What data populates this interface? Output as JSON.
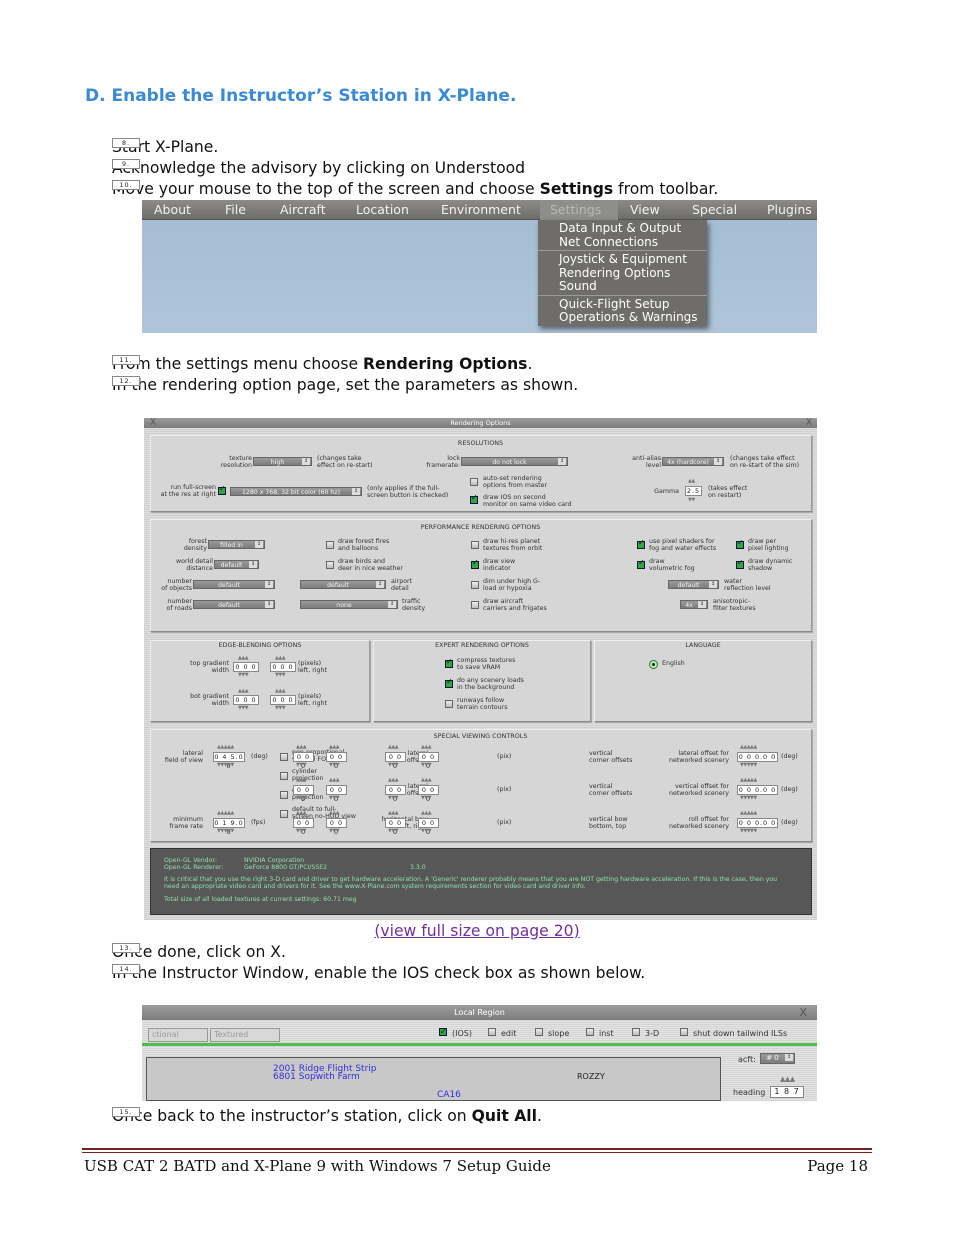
{
  "heading": "D.  Enable the Instructor’s Station in X-Plane.",
  "steps": [
    {
      "num": "8.",
      "text": "Start X-Plane."
    },
    {
      "num": "9.",
      "text": "Acknowledge the advisory by clicking on Understood"
    },
    {
      "num": "10.",
      "pre": "Move your mouse to the top of the screen and choose ",
      "bold": "Settings",
      "post": " from toolbar."
    },
    {
      "num": "11.",
      "pre": "From the settings menu choose ",
      "bold": "Rendering Options",
      "post": "."
    },
    {
      "num": "12.",
      "text": "In the rendering option page, set the parameters as shown."
    },
    {
      "num": "13.",
      "text": "Once done, click on X."
    },
    {
      "num": "14.",
      "text": "In the Instructor Window, enable the IOS check box as shown below."
    },
    {
      "num": "15.",
      "pre": "Once back to the instructor’s station, click on ",
      "bold": "Quit All",
      "post": "."
    }
  ],
  "menu": {
    "items": [
      "About",
      "File",
      "Aircraft",
      "Location",
      "Environment",
      "Settings",
      "View",
      "Special",
      "Plugins"
    ],
    "active": "Settings",
    "dropdown": [
      [
        "Data Input & Output",
        "Net Connections"
      ],
      [
        "Joystick & Equipment",
        "Rendering Options",
        "Sound"
      ],
      [
        "Quick-Flight Setup",
        "Operations & Warnings"
      ]
    ]
  },
  "render": {
    "title": "Rendering Options",
    "close": "X",
    "res": {
      "header": "RESOLUTIONS",
      "texture_label": "texture\nresolution",
      "texture_value": "high",
      "texture_note": "(changes take\neffect on re-start)",
      "lock_label": "lock\nframerate:",
      "lock_value": "do not lock",
      "aa_label": "anti-alias\nlevel",
      "aa_value": "4x (hardcore)",
      "aa_note": "(changes take effect\non re-start of the sim)",
      "fs_label": "run full-screen\nat the res at right",
      "fs_checked": true,
      "fs_value": "1280 x 768, 32 bit color (60 hz)",
      "fs_note": "(only applies if the full-\nscreen button is checked)",
      "autoset": "auto-set rendering\noptions from master",
      "autoset_checked": false,
      "ios": "draw IOS on second\nmonitor on same video card",
      "ios_checked": true,
      "gamma_label": "Gamma",
      "gamma_value": "2.5",
      "gamma_note": "(takes effect\non restart)"
    },
    "perf": {
      "header": "PERFORMANCE RENDERING OPTIONS",
      "forest_label": "forest\ndensity",
      "forest_value": "filled in",
      "world_label": "world detail\ndistance",
      "world_value": "default",
      "objects_label": "number\nof objects",
      "objects_value": "default",
      "roads_label": "number\nof roads",
      "roads_value": "default",
      "fires": "draw forest fires\nand balloons",
      "fires_checked": false,
      "birds": "draw birds and\ndeer in nice weather",
      "birds_checked": false,
      "airport_value": "default",
      "airport_label": "airport\ndetail",
      "traffic_value": "none",
      "traffic_label": "traffic\ndensity",
      "hires": "draw hi-res planet\ntextures from orbit",
      "hires_checked": false,
      "viewind": "draw view\nindicator",
      "viewind_checked": true,
      "dim": "dim under high G-\nload or hypoxia",
      "dim_checked": false,
      "carriers": "draw aircraft\ncarriers and frigates",
      "carriers_checked": false,
      "shaders": "use pixel shaders for\nfog and water effects",
      "shaders_checked": true,
      "volfog": "draw\nvolumetric fog",
      "volfog_checked": true,
      "perpixel": "draw per\npixel lighting",
      "perpixel_checked": true,
      "shadow": "draw dynamic\nshadow",
      "shadow_checked": true,
      "water_value": "default",
      "water_label": "water\nreflection level",
      "aniso_value": "4x",
      "aniso_label": "anisotropic-\nfilter textures"
    },
    "edge": {
      "header": "EDGE-BLENDING OPTIONS",
      "top_label": "top gradient\nwidth",
      "bot_label": "bot gradient\nwidth",
      "v1": "0 0 0",
      "v2": "0 0 0",
      "v3": "0 0 0",
      "v4": "0 0 0",
      "note": "(pixels)\nleft, right"
    },
    "expert": {
      "header": "EXPERT RENDERING OPTIONS",
      "compress": "compress textures\nto save VRAM",
      "compress_checked": true,
      "bgload": "do any scenery loads\nin the background",
      "bgload_checked": true,
      "runways": "runways follow\nterrain contours",
      "runways_checked": false
    },
    "lang": {
      "header": "LANGUAGE",
      "english": "English"
    },
    "special": {
      "header": "SPECIAL VIEWING CONTROLS",
      "fov_label": "lateral\nfield of view",
      "fov_value": "0 4 5.0 0",
      "deg": "(deg)",
      "fps_label": "minimum\nframe rate",
      "fps_value": "0 1 9.0 0",
      "fps": "(fps)",
      "nonprop": "non-proportional\nvertical FOV",
      "cylinder": "cylinder\nprojection",
      "dome": "dome\nprojection",
      "nohud": "default to full-\nscreen no-HUD view",
      "lat_corner": "lateral\ncorner offsets",
      "horiz_bow": "horizontal bow\nleft, right",
      "pix": "(pix)",
      "zero3": "0 0 0",
      "vert_corner": "vertical\ncorner offsets",
      "vert_bow": "vertical bow\nbottom, top",
      "lat_net": "lateral offset for\nnetworked scenery",
      "vert_net": "vertical offset for\nnetworked scenery",
      "roll_net": "roll offset for\nnetworked scenery",
      "net_value": "0 0 0.0 0"
    },
    "info": {
      "vendor_label": "Open-GL Vendor:",
      "vendor": "NVIDIA Corporation",
      "renderer_label": "Open-GL Renderer:",
      "renderer": "GeForce 8800 GT/PCI/SSE2",
      "version": "3.3.0",
      "warning": "It is critical that you use the right 3-D card and driver to get hardware acceleration. A 'Generic' renderer probably means that you are NOT getting hardware acceleration. If this is the case, then you need an appropriate video card and drivers for it. See the www.X-Plane.com system requirements section for video card and driver info.",
      "textures": "Total size of all loaded textures at current settings: 60.71 meg"
    }
  },
  "link": "(view full size on page 20)",
  "local": {
    "title": "Local Region",
    "close": "X",
    "tab1": "ctional",
    "tab2": "Textured",
    "checks": [
      {
        "label": "(IOS)",
        "checked": true
      },
      {
        "label": "edit",
        "checked": false
      },
      {
        "label": "slope",
        "checked": false
      },
      {
        "label": "inst",
        "checked": false
      },
      {
        "label": "3-D",
        "checked": false
      },
      {
        "label": "shut down tailwind ILSs",
        "checked": false
      }
    ],
    "acft_label": "acft:",
    "acft_value": "# 0",
    "heading_label": "heading",
    "heading_value": "1 8 7",
    "map": [
      "2001 Ridge Flight Strip",
      "6801 Sopwith Farm",
      "ROZZY",
      "CA16"
    ]
  },
  "footer": {
    "left": "USB CAT 2 BATD and X-Plane 9 with Windows 7 Setup Guide",
    "right": "Page 18"
  }
}
